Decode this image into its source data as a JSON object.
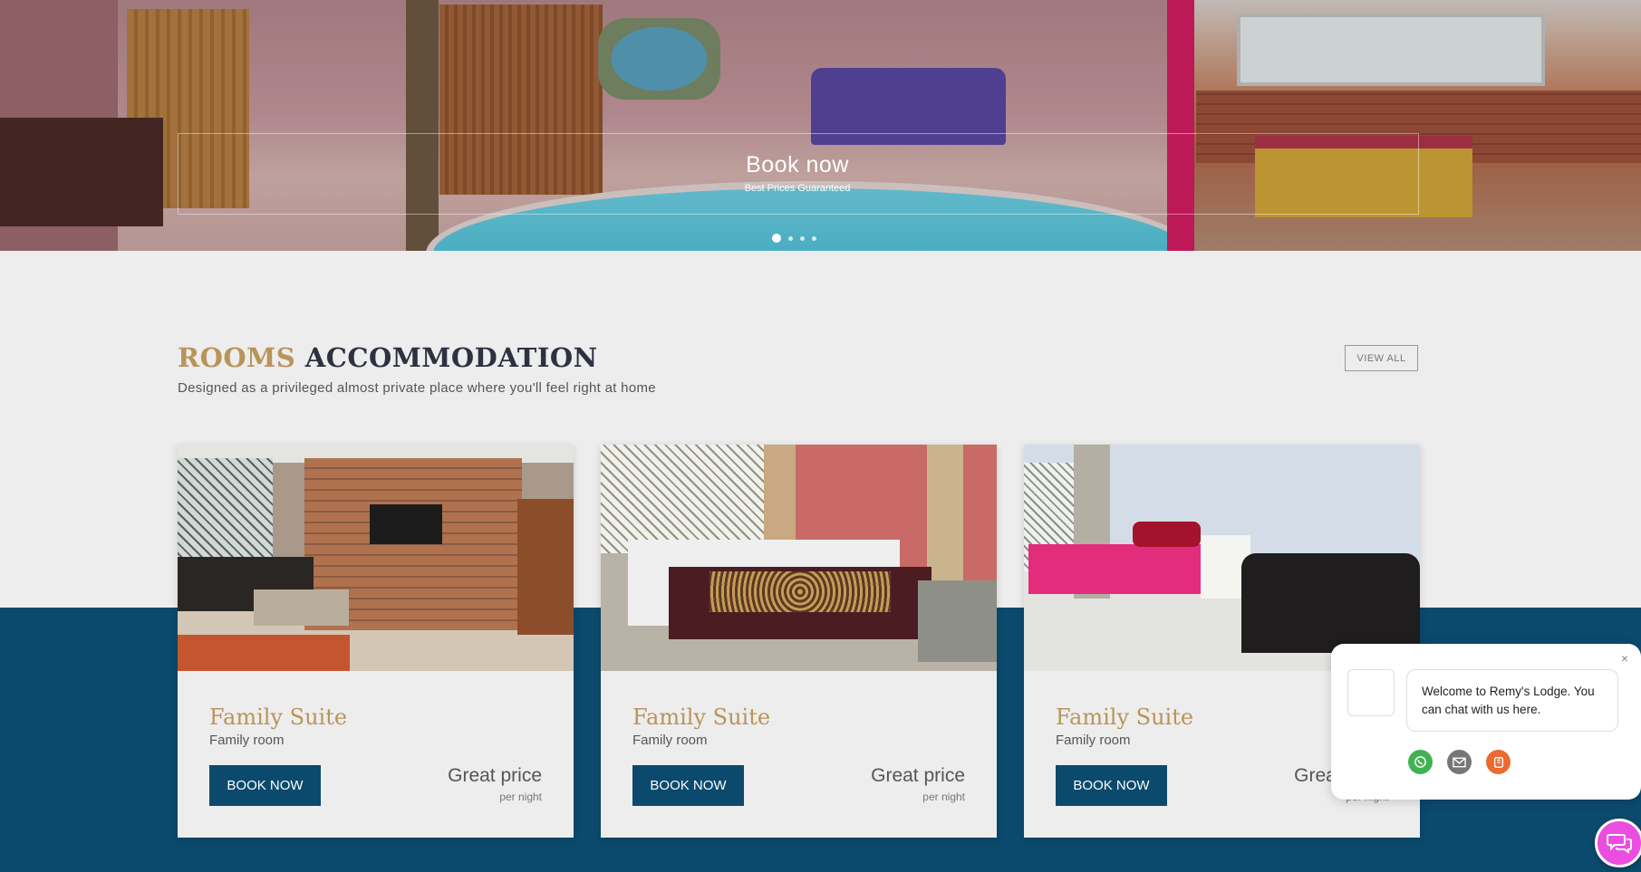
{
  "hero": {
    "headline": "Book now",
    "subline": "Best Prices Guaranteed",
    "slides": 4,
    "active_slide": 1
  },
  "section": {
    "title_accent": "ROOMS",
    "title_rest": "ACCOMMODATION",
    "subtitle": "Designed as a privileged almost private place where you'll feel right at home",
    "view_all_label": "VIEW ALL"
  },
  "rooms": [
    {
      "name": "Family Suite",
      "type": "Family room",
      "book_label": "BOOK NOW",
      "price_label": "Great price",
      "price_unit": "per night"
    },
    {
      "name": "Family Suite",
      "type": "Family room",
      "book_label": "BOOK NOW",
      "price_label": "Great price",
      "price_unit": "per night"
    },
    {
      "name": "Family Suite",
      "type": "Family room",
      "book_label": "BOOK NOW",
      "price_label": "Great price",
      "price_unit": "per night"
    }
  ],
  "chat": {
    "message": "Welcome to Remy's Lodge. You can chat with us here.",
    "close_label": "×",
    "channels": [
      "whatsapp-icon",
      "email-icon",
      "phone-icon"
    ]
  },
  "colors": {
    "accent_gold": "#b9945a",
    "navy": "#0b4a6d",
    "chat_launcher": "#ea4de0"
  }
}
